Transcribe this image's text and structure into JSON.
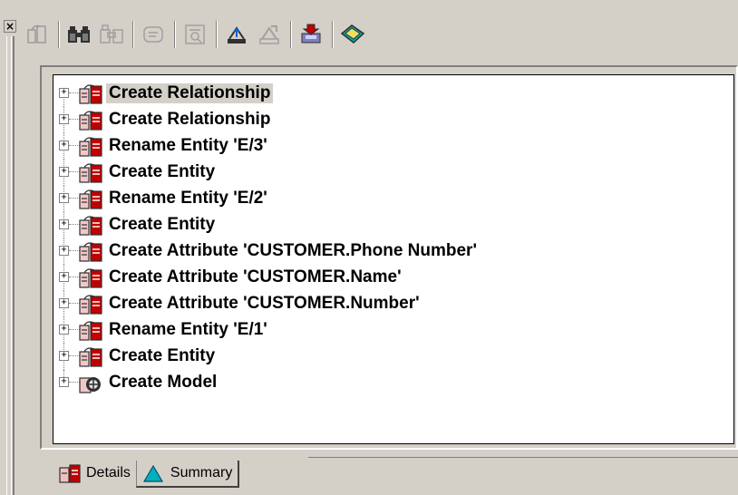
{
  "toolbar": {
    "buttons": [
      {
        "icon": "rollback-icon",
        "enabled": false
      },
      {
        "icon": "find-icon",
        "enabled": true
      },
      {
        "icon": "find-next-icon",
        "enabled": false
      },
      {
        "icon": "comment-icon",
        "enabled": false
      },
      {
        "icon": "properties-icon",
        "enabled": false
      },
      {
        "icon": "import-icon",
        "enabled": true
      },
      {
        "icon": "export-icon",
        "enabled": false
      },
      {
        "icon": "save-to-model-icon",
        "enabled": true
      },
      {
        "icon": "bookmark-icon",
        "enabled": true
      }
    ]
  },
  "tree": {
    "items": [
      {
        "label": "Create Relationship",
        "icon": "transaction-icon",
        "selected": true
      },
      {
        "label": "Create Relationship",
        "icon": "transaction-icon"
      },
      {
        "label": "Rename Entity 'E/3'",
        "icon": "transaction-icon"
      },
      {
        "label": "Create Entity",
        "icon": "transaction-icon"
      },
      {
        "label": "Rename Entity 'E/2'",
        "icon": "transaction-icon"
      },
      {
        "label": "Create Entity",
        "icon": "transaction-icon"
      },
      {
        "label": "Create Attribute 'CUSTOMER.Phone Number'",
        "icon": "transaction-icon"
      },
      {
        "label": "Create Attribute 'CUSTOMER.Name'",
        "icon": "transaction-icon"
      },
      {
        "label": "Create Attribute 'CUSTOMER.Number'",
        "icon": "transaction-icon"
      },
      {
        "label": "Rename Entity 'E/1'",
        "icon": "transaction-icon"
      },
      {
        "label": "Create Entity",
        "icon": "transaction-icon"
      },
      {
        "label": "Create Model",
        "icon": "model-icon"
      }
    ]
  },
  "tabs": [
    {
      "label": "Details",
      "icon": "details-icon",
      "active": true
    },
    {
      "label": "Summary",
      "icon": "summary-triangle-icon",
      "active": false
    }
  ],
  "colors": {
    "face": "#d4d0c8",
    "shadow": "#808080",
    "highlight": "#ffffff",
    "accent_red": "#c00000",
    "accent_teal": "#00a0a0"
  }
}
